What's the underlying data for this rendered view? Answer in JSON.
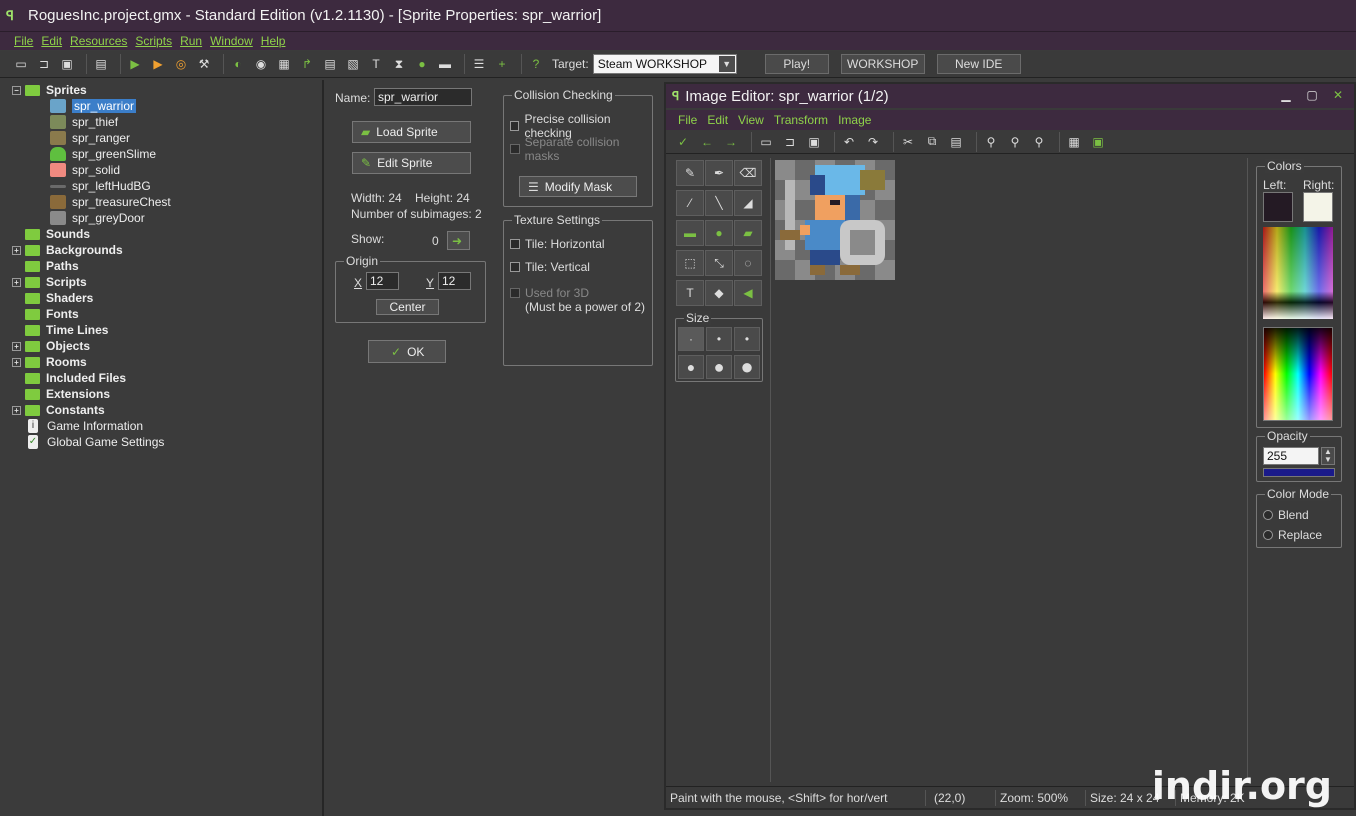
{
  "window": {
    "title": "RoguesInc.project.gmx  -  Standard Edition (v1.2.1130) - [Sprite Properties: spr_warrior]"
  },
  "menu": [
    "File",
    "Edit",
    "Resources",
    "Scripts",
    "Run",
    "Window",
    "Help"
  ],
  "toolbar": {
    "target_label": "Target:",
    "target_value": "Steam WORKSHOP",
    "play_label": "Play!",
    "workshop_label": "WORKSHOP",
    "newide_label": "New IDE"
  },
  "tree": {
    "sprites_label": "Sprites",
    "sprites": [
      "spr_warrior",
      "spr_thief",
      "spr_ranger",
      "spr_greenSlime",
      "spr_solid",
      "spr_leftHudBG",
      "spr_treasureChest",
      "spr_greyDoor"
    ],
    "folders": [
      "Sounds",
      "Backgrounds",
      "Paths",
      "Scripts",
      "Shaders",
      "Fonts",
      "Time Lines",
      "Objects",
      "Rooms",
      "Included Files",
      "Extensions",
      "Constants"
    ],
    "extras": [
      "Game Information",
      "Global Game Settings"
    ]
  },
  "sprite_props": {
    "name_label": "Name:",
    "name_value": "spr_warrior",
    "load_label": "Load Sprite",
    "edit_label": "Edit Sprite",
    "width_text": "Width: 24",
    "height_text": "Height: 24",
    "subimages_text": "Number of subimages: 2",
    "show_label": "Show:",
    "show_value": "0",
    "origin_label": "Origin",
    "x_label": "X",
    "x_value": "12",
    "y_label": "Y",
    "y_value": "12",
    "center_label": "Center",
    "ok_label": "OK",
    "collision_label": "Collision Checking",
    "precise_label": "Precise collision checking",
    "separate_label": "Separate collision masks",
    "modify_mask_label": "Modify Mask",
    "texture_label": "Texture Settings",
    "tile_h_label": "Tile: Horizontal",
    "tile_v_label": "Tile: Vertical",
    "used3d_label": "Used for 3D",
    "power2_label": "(Must be a power of 2)"
  },
  "image_editor": {
    "title": "Image Editor: spr_warrior (1/2)",
    "menu": [
      "File",
      "Edit",
      "View",
      "Transform",
      "Image"
    ],
    "size_label": "Size",
    "colors_label": "Colors",
    "left_label": "Left:",
    "right_label": "Right:",
    "left_color": "#241a24",
    "right_color": "#f4f4e8",
    "opacity_label": "Opacity",
    "opacity_value": "255",
    "color_mode_label": "Color Mode",
    "blend_label": "Blend",
    "replace_label": "Replace",
    "status_hint": "Paint with the mouse, <Shift> for hor/vert",
    "status_coords": "(22,0)",
    "status_zoom": "Zoom: 500%",
    "status_size": "Size: 24 x 24",
    "status_memory": "Memory: 2K"
  },
  "watermark": "indir.org",
  "colors": {
    "accent": "#8fd24a",
    "title_bg": "#3d2a3f",
    "selection": "#3b7ec9"
  }
}
